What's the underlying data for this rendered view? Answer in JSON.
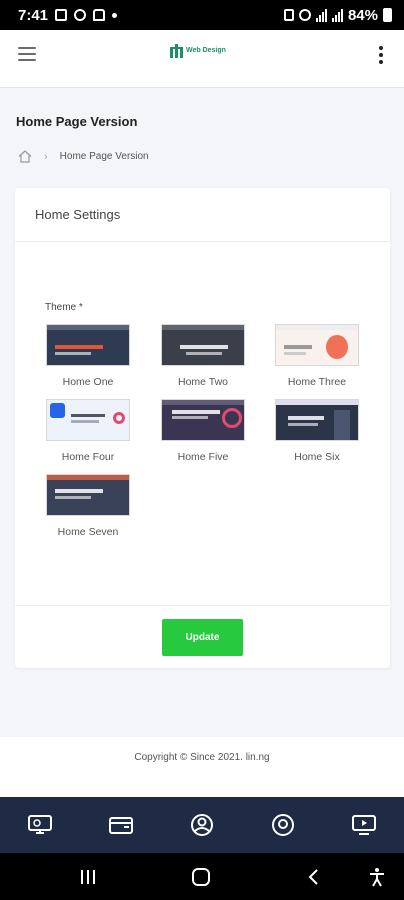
{
  "status_bar": {
    "time": "7:41",
    "battery": "84%"
  },
  "header": {
    "logo_text": "Web Design"
  },
  "page": {
    "title": "Home Page Version",
    "breadcrumb_current": "Home Page Version"
  },
  "card": {
    "title": "Home Settings",
    "theme_label": "Theme *",
    "themes": [
      {
        "name": "Home One",
        "color": "#2f3b52",
        "accent": "#e0583a"
      },
      {
        "name": "Home Two",
        "color": "#3a3f4a",
        "accent": "#f5f5f5"
      },
      {
        "name": "Home Three",
        "color": "#f8f1ee",
        "accent": "#ef5a3c"
      },
      {
        "name": "Home Four",
        "color": "#eef3fb",
        "accent": "#2763e8"
      },
      {
        "name": "Home Five",
        "color": "#3b3552",
        "accent": "#e14c6e"
      },
      {
        "name": "Home Six",
        "color": "#2c3447",
        "accent": "#f5f5f5"
      },
      {
        "name": "Home Seven",
        "color": "#3a4258",
        "accent": "#ef6a3c"
      }
    ],
    "update_label": "Update"
  },
  "footer": {
    "copyright": "Copyright © Since 2021. lin.ng"
  },
  "bottom_nav": [
    "monitor-icon",
    "wallet-icon",
    "user-icon",
    "location-icon",
    "tv-play-icon"
  ],
  "colors": {
    "accent": "#27c93f",
    "brand": "#1a8f6b",
    "nav_bg": "#1f2a44"
  }
}
